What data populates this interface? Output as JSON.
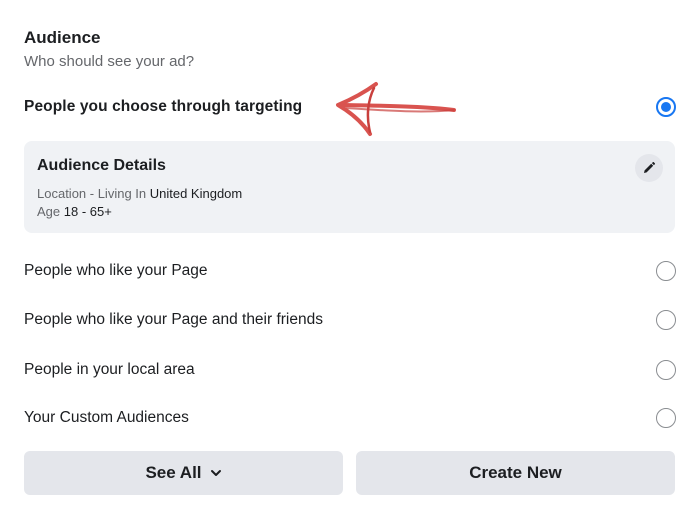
{
  "audience": {
    "title": "Audience",
    "subtitle": "Who should see your ad?"
  },
  "options": {
    "targeting": {
      "label": "People you choose through targeting",
      "selected": true
    },
    "page_likers": {
      "label": "People who like your Page",
      "selected": false
    },
    "page_likers_friends": {
      "label": "People who like your Page and their friends",
      "selected": false
    },
    "local_area": {
      "label": "People in your local area",
      "selected": false
    },
    "custom": {
      "label": "Your Custom Audiences",
      "selected": false
    }
  },
  "details": {
    "title": "Audience Details",
    "location_prefix": "Location - Living In ",
    "location_value": "United Kingdom",
    "age_prefix": "Age ",
    "age_value": "18 - 65+",
    "edit_icon": "pencil-icon"
  },
  "buttons": {
    "see_all": "See All",
    "create_new": "Create New"
  },
  "colors": {
    "accent": "#1877f2",
    "annotation_arrow": "#d9534f"
  }
}
